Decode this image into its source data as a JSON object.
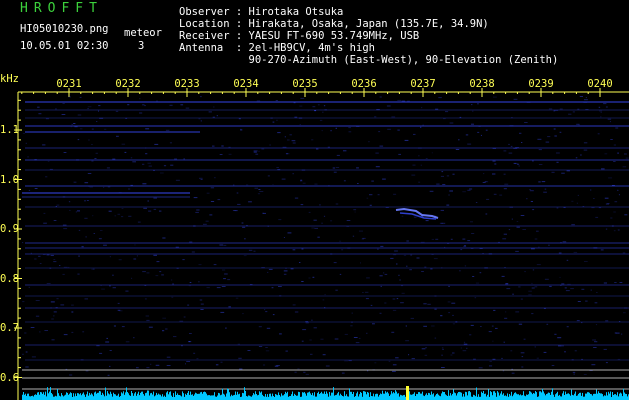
{
  "header": {
    "title": "HROFFT",
    "filename": "HI05010230.png",
    "meteor_label": "meteor",
    "meteor_count": "3",
    "datetime": "10.05.01 02:30",
    "observer": "Observer : Hirotaka Otsuka",
    "location": "Location : Hirakata, Osaka, Japan (135.7E, 34.9N)",
    "receiver": "Receiver : YAESU FT-690 53.749MHz, USB",
    "antenna_1": "Antenna  : 2el-HB9CV, 4m's high",
    "antenna_2": "           90-270-Azimuth (East-West), 90-Elevation (Zenith)"
  },
  "axis": {
    "unit": "kHz",
    "time_ticks": [
      "0231",
      "0232",
      "0233",
      "0234",
      "0235",
      "0236",
      "0237",
      "0238",
      "0239",
      "0240"
    ],
    "freq_ticks": [
      {
        "label": "1.1",
        "value": 1.1
      },
      {
        "label": "1.0",
        "value": 1.0
      },
      {
        "label": "0.9",
        "value": 0.9
      },
      {
        "label": "0.8",
        "value": 0.8
      },
      {
        "label": "0.7",
        "value": 0.7
      },
      {
        "label": "0.6",
        "value": 0.6
      }
    ]
  },
  "colors": {
    "background": "#000000",
    "title": "#3cd13c",
    "text": "#ffffff",
    "axis_text": "#ffff55",
    "axis_line": "#ffff55",
    "signal": "#3a4dff",
    "noise_bar": "#00c8ff",
    "reference_line": "#d0d0d0"
  }
}
